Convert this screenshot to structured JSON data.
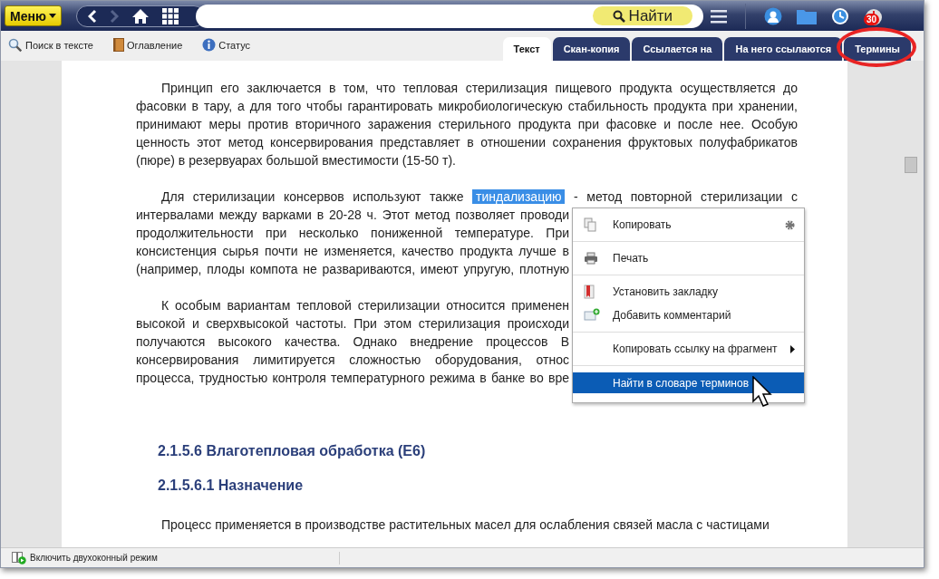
{
  "topbar": {
    "menu_button": "Меню",
    "find_button": "Найти",
    "notification_count": "30"
  },
  "toolbar": [
    {
      "kind": "search",
      "label": "Поиск в тексте"
    },
    {
      "kind": "book",
      "label": "Оглавление"
    },
    {
      "kind": "info",
      "label": "Статус"
    }
  ],
  "tabs": [
    {
      "label": "Текст",
      "selected": true,
      "circled": false
    },
    {
      "label": "Скан-копия",
      "selected": false,
      "circled": false
    },
    {
      "label": "Ссылается на",
      "selected": false,
      "circled": false
    },
    {
      "label": "На него ссылаются",
      "selected": false,
      "circled": false
    },
    {
      "label": "Термины",
      "selected": false,
      "circled": true
    }
  ],
  "document": {
    "paragraphs": [
      {
        "lines": [
          {
            "text": "Принцип его заключается в том, что тепловая стерилизация пищевого продукта осуществляется до",
            "clipped": false
          },
          {
            "text": "фасовки в тару, а для того чтобы гарантировать микробиологическую стабильность продукта при хранении,",
            "clipped": false
          },
          {
            "text": "принимают меры против вторичного заражения стерильного продукта при фасовке и после нее. Особую",
            "clipped": false
          },
          {
            "text": "ценность этот метод консервирования представляет в отношении сохранения фруктовых полуфабрикатов",
            "clipped": false
          },
          {
            "text": "(пюре) в резервуарах большой вместимости (15-50 т).",
            "clipped": false
          }
        ]
      },
      {
        "lines": [
          {
            "segments": [
              {
                "text": "Для стерилизации консервов используют также",
                "highlighted": false
              },
              {
                "text": "тиндализацию",
                "highlighted": true
              },
              {
                "text": "- метод повторной стерилизации с",
                "highlighted": false
              }
            ],
            "clipped": false
          },
          {
            "text": "интервалами между варками в 20-28 ч. Этот метод позволяет проводи",
            "clipped": true
          },
          {
            "text": "продолжительности при несколько пониженной температуре. При",
            "clipped": true
          },
          {
            "text": "консистенция сырья почти не изменяется, качество продукта лучше в",
            "clipped": true
          },
          {
            "text": "(например, плоды компота не развариваются, имеют упругую, плотную",
            "clipped": true
          }
        ]
      },
      {
        "lines": [
          {
            "text": "К особым вариантам тепловой стерилизации относится применен",
            "clipped": true
          },
          {
            "text": "высокой и сверхвысокой частоты. При этом стерилизация происходи",
            "clipped": true
          },
          {
            "text": "получаются высокого качества. Однако внедрение процессов В",
            "clipped": true
          },
          {
            "text": "консервирования лимитируется сложностью оборудования, относ",
            "clipped": true
          },
          {
            "text": "процесса, трудностью контроля температурного режима в банке во вре",
            "clipped": true
          }
        ]
      }
    ],
    "headings": [
      "2.1.5.6 Влаготепловая обработка (Е6)",
      "2.1.5.6.1 Назначение"
    ],
    "last_line": "Процесс применяется в производстве растительных масел для ослабления связей масла с частицами"
  },
  "context_menu": {
    "groups": [
      [
        {
          "kind": "copy",
          "label": "Копировать",
          "selected": false
        }
      ],
      [
        {
          "kind": "print",
          "label": "Печать",
          "selected": false
        }
      ],
      [
        {
          "kind": "bookmark",
          "label": "Установить закладку",
          "selected": false
        },
        {
          "kind": "comment",
          "label": "Добавить комментарий",
          "selected": false
        }
      ],
      [
        {
          "kind": "link",
          "label": "Копировать ссылку на фрагмент",
          "selected": false
        }
      ],
      [
        {
          "kind": "lookup",
          "label": "Найти в словаре терминов",
          "selected": true
        }
      ]
    ]
  },
  "status_bar": {
    "label": "Включить двухоконный режим"
  }
}
